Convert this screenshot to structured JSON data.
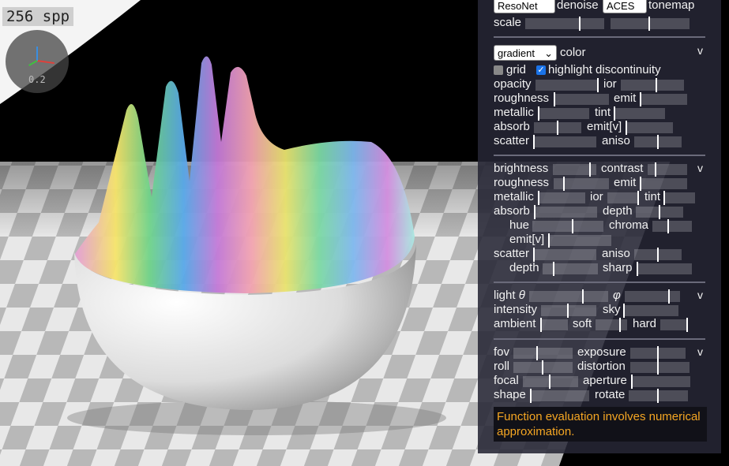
{
  "overlay": {
    "spp": "256 spp",
    "gizmo_value": "0.2"
  },
  "top": {
    "denoise_select": "ResoNet",
    "denoise_label": "denoise",
    "tonemap_select": "ACES",
    "tonemap_label": "tonemap",
    "scale_label": "scale"
  },
  "material": {
    "color_mode": "gradient",
    "color_label": "color",
    "toggle": "v",
    "grid_label": "grid",
    "grid_checked": false,
    "highlight_label": "highlight discontinuity",
    "highlight_checked": true,
    "opacity": "opacity",
    "ior": "ior",
    "roughness": "roughness",
    "emit": "emit",
    "metallic": "metallic",
    "tint": "tint",
    "absorb": "absorb",
    "emit_v": "emit[v]",
    "scatter": "scatter",
    "aniso": "aniso"
  },
  "volume": {
    "toggle": "v",
    "brightness": "brightness",
    "contrast": "contrast",
    "roughness": "roughness",
    "emit": "emit",
    "metallic": "metallic",
    "ior": "ior",
    "tint": "tint",
    "absorb": "absorb",
    "depth": "depth",
    "hue": "hue",
    "chroma": "chroma",
    "emit_v": "emit[v]",
    "scatter": "scatter",
    "aniso": "aniso",
    "depth2": "depth",
    "sharp": "sharp"
  },
  "lighting": {
    "toggle": "v",
    "light": "light",
    "theta": "θ",
    "phi": "φ",
    "intensity": "intensity",
    "sky": "sky",
    "ambient": "ambient",
    "soft": "soft",
    "hard": "hard"
  },
  "camera": {
    "toggle": "v",
    "fov": "fov",
    "exposure": "exposure",
    "roll": "roll",
    "distortion": "distortion",
    "focal": "focal",
    "aperture": "aperture",
    "shape": "shape",
    "rotate": "rotate"
  },
  "warning": "Function evaluation involves numerical approximation.",
  "colors": {
    "warning": "#f5a623",
    "panel": "#26263a",
    "checkbox": "#1a73e8"
  }
}
